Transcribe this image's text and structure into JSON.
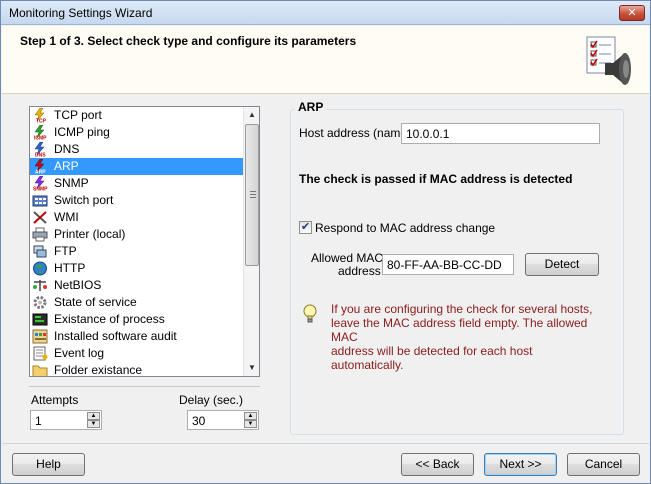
{
  "window": {
    "title": "Monitoring Settings Wizard",
    "close_glyph": "✕"
  },
  "header": {
    "step_text": "Step 1 of 3. Select check type and configure its parameters",
    "icon": "checklist-speaker-icon"
  },
  "check_types": {
    "items": [
      {
        "label": "TCP port",
        "icon": "tcp-icon"
      },
      {
        "label": "ICMP ping",
        "icon": "icmp-icon"
      },
      {
        "label": "DNS",
        "icon": "dns-icon"
      },
      {
        "label": "ARP",
        "icon": "arp-icon",
        "selected": true
      },
      {
        "label": "SNMP",
        "icon": "snmp-icon"
      },
      {
        "label": "Switch port",
        "icon": "switch-icon"
      },
      {
        "label": "WMI",
        "icon": "wmi-icon"
      },
      {
        "label": "Printer (local)",
        "icon": "printer-icon"
      },
      {
        "label": "FTP",
        "icon": "ftp-icon"
      },
      {
        "label": "HTTP",
        "icon": "globe-icon"
      },
      {
        "label": "NetBIOS",
        "icon": "netbios-icon"
      },
      {
        "label": "State of service",
        "icon": "gear-icon"
      },
      {
        "label": "Existance of process",
        "icon": "process-icon"
      },
      {
        "label": "Installed software audit",
        "icon": "software-icon"
      },
      {
        "label": "Event log",
        "icon": "eventlog-icon"
      },
      {
        "label": "Folder existance",
        "icon": "folder-icon"
      }
    ]
  },
  "attempts": {
    "label": "Attempts",
    "value": "1"
  },
  "delay": {
    "label": "Delay (sec.)",
    "value": "30"
  },
  "arp": {
    "group_title": "ARP",
    "host_label": "Host address (name)",
    "host_value": "10.0.0.1",
    "pass_condition": "The check is passed if MAC address is detected",
    "respond_checkbox_label": "Respond to MAC address change",
    "respond_checked": true,
    "allowed_mac_label_1": "Allowed MAC",
    "allowed_mac_label_2": "address",
    "allowed_mac_value": "80-FF-AA-BB-CC-DD",
    "detect_button": "Detect",
    "hint_line_1": "If you are configuring the check for several hosts,",
    "hint_line_2": "leave the MAC address field empty. The allowed MAC",
    "hint_line_3": "address will be detected for each host automatically.",
    "hint_icon": "lightbulb-icon"
  },
  "buttons": {
    "help": "Help",
    "back": "<< Back",
    "next": "Next >>",
    "cancel": "Cancel"
  },
  "colors": {
    "selection": "#3399ff",
    "hint_text": "#8b1c1c",
    "header_bg": "#fefcf3"
  }
}
